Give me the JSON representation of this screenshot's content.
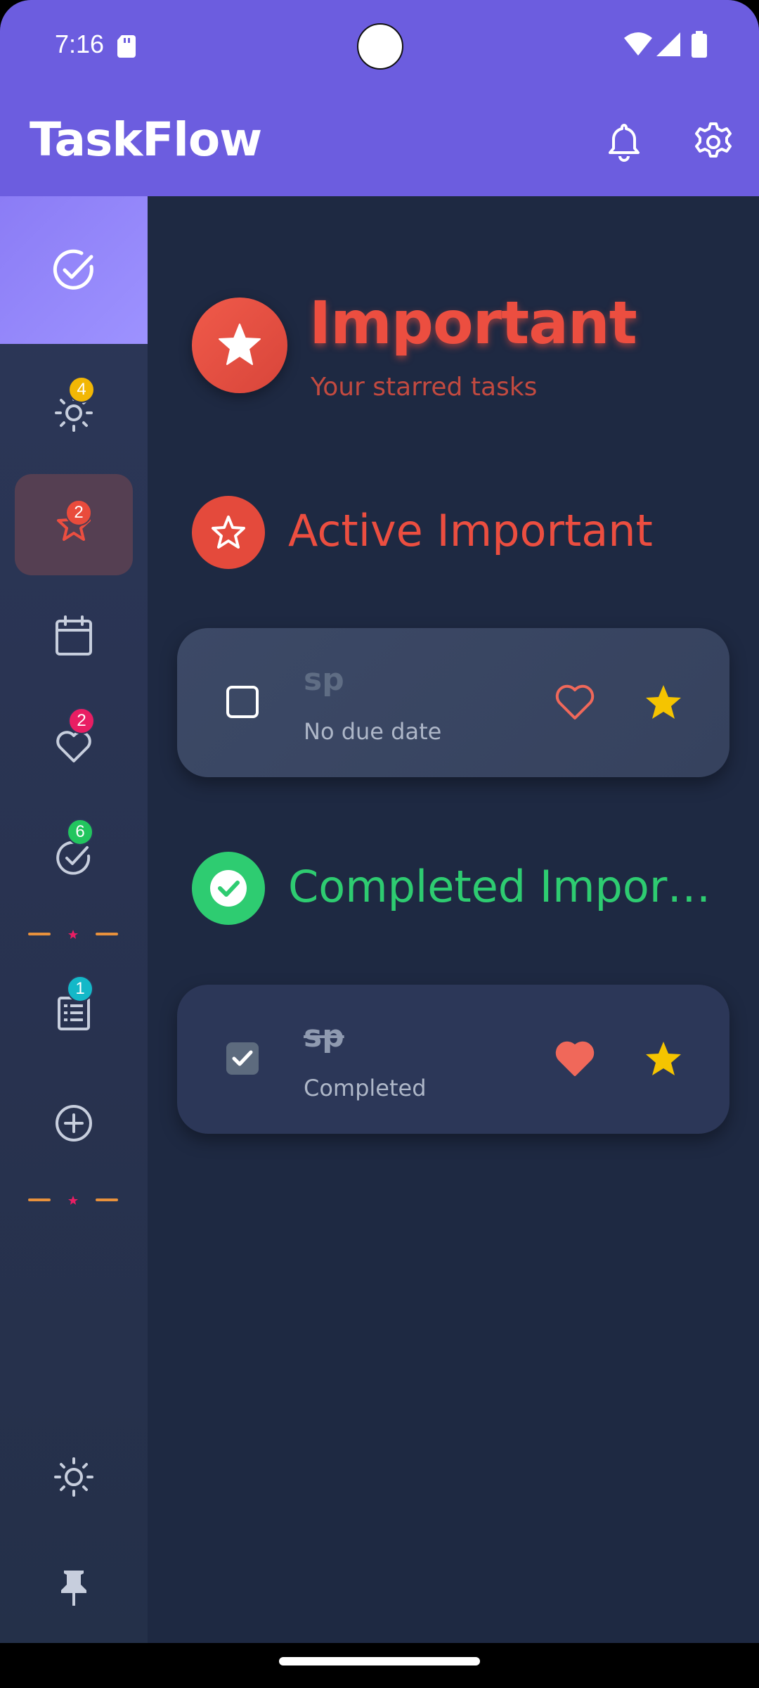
{
  "status_bar": {
    "time": "7:16"
  },
  "app_bar": {
    "title": "TaskFlow"
  },
  "sidebar": {
    "items": [
      {
        "name": "all-tasks",
        "icon": "check-circle-icon",
        "badge": ""
      },
      {
        "name": "today",
        "icon": "sun-icon",
        "badge": "4",
        "badge_color": "#f2b705"
      },
      {
        "name": "important",
        "icon": "star-icon",
        "badge": "2",
        "badge_color": "#e94b3c"
      },
      {
        "name": "calendar",
        "icon": "calendar-icon",
        "badge": ""
      },
      {
        "name": "favorites",
        "icon": "heart-icon",
        "badge": "2",
        "badge_color": "#e91e63"
      },
      {
        "name": "completed",
        "icon": "check-circle-icon",
        "badge": "6",
        "badge_color": "#22c55e"
      },
      {
        "name": "lists",
        "icon": "list-icon",
        "badge": "1",
        "badge_color": "#14b8c8"
      },
      {
        "name": "add",
        "icon": "plus-circle-icon",
        "badge": ""
      },
      {
        "name": "theme",
        "icon": "sun-icon",
        "badge": ""
      },
      {
        "name": "pin",
        "icon": "pin-icon",
        "badge": ""
      }
    ]
  },
  "page": {
    "title": "Important",
    "subtitle": "Your starred tasks"
  },
  "sections": {
    "active": {
      "title": "Active Important",
      "color": "#ec4e40"
    },
    "completed": {
      "title": "Completed Important",
      "color": "#2ecc71"
    }
  },
  "tasks": {
    "active": [
      {
        "name": "sp",
        "meta": "No due date",
        "favorite": false,
        "starred": true,
        "done": false
      }
    ],
    "completed": [
      {
        "name": "sp",
        "meta": "Completed",
        "favorite": true,
        "starred": true,
        "done": true
      }
    ]
  },
  "colors": {
    "accent": "#6c5ddf",
    "background": "#1e2942",
    "danger": "#ec4e40",
    "success": "#2ecc71",
    "star": "#f5c400",
    "heart": "#f0685a"
  }
}
